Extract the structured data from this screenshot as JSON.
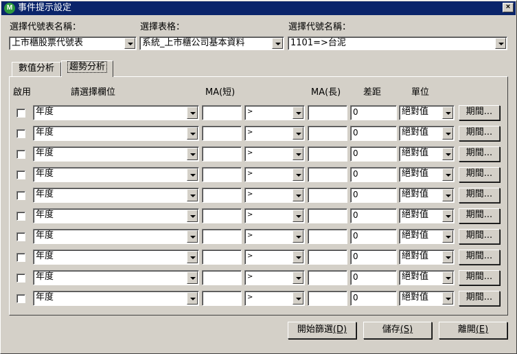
{
  "window": {
    "title": "事件提示設定",
    "icon": "M",
    "close": "×"
  },
  "top": {
    "code_table_label": "選擇代號表名稱：",
    "code_table_value": "上市櫃股票代號表",
    "table_label": "選擇表格：",
    "table_value": "系統_上市櫃公司基本資料",
    "code_name_label": "選擇代號名稱：",
    "code_name_value": "1101=>台泥"
  },
  "tabs": [
    {
      "label": "數值分析",
      "active": false
    },
    {
      "label": "趨勢分析",
      "active": true
    }
  ],
  "headers": {
    "enable": "啟用",
    "field": "請選擇欄位",
    "ma_short": "MA(短)",
    "ma_long": "MA(長)",
    "diff": "差距",
    "unit": "單位"
  },
  "rows": [
    {
      "field": "年度",
      "ma_short": "",
      "operator": ">",
      "ma_long": "",
      "diff": "0",
      "unit": "絕對值",
      "period": "期間..."
    },
    {
      "field": "年度",
      "ma_short": "",
      "operator": ">",
      "ma_long": "",
      "diff": "0",
      "unit": "絕對值",
      "period": "期間..."
    },
    {
      "field": "年度",
      "ma_short": "",
      "operator": ">",
      "ma_long": "",
      "diff": "0",
      "unit": "絕對值",
      "period": "期間..."
    },
    {
      "field": "年度",
      "ma_short": "",
      "operator": ">",
      "ma_long": "",
      "diff": "0",
      "unit": "絕對值",
      "period": "期間..."
    },
    {
      "field": "年度",
      "ma_short": "",
      "operator": ">",
      "ma_long": "",
      "diff": "0",
      "unit": "絕對值",
      "period": "期間..."
    },
    {
      "field": "年度",
      "ma_short": "",
      "operator": ">",
      "ma_long": "",
      "diff": "0",
      "unit": "絕對值",
      "period": "期間..."
    },
    {
      "field": "年度",
      "ma_short": "",
      "operator": ">",
      "ma_long": "",
      "diff": "0",
      "unit": "絕對值",
      "period": "期間..."
    },
    {
      "field": "年度",
      "ma_short": "",
      "operator": ">",
      "ma_long": "",
      "diff": "0",
      "unit": "絕對值",
      "period": "期間..."
    },
    {
      "field": "年度",
      "ma_short": "",
      "operator": ">",
      "ma_long": "",
      "diff": "0",
      "unit": "絕對值",
      "period": "期間..."
    },
    {
      "field": "年度",
      "ma_short": "",
      "operator": ">",
      "ma_long": "",
      "diff": "0",
      "unit": "絕對值",
      "period": "期間..."
    }
  ],
  "buttons": {
    "filter": "開始篩選",
    "filter_key": "(D)",
    "save": "儲存",
    "save_key": "(S)",
    "exit": "離開",
    "exit_key": "(E)"
  }
}
